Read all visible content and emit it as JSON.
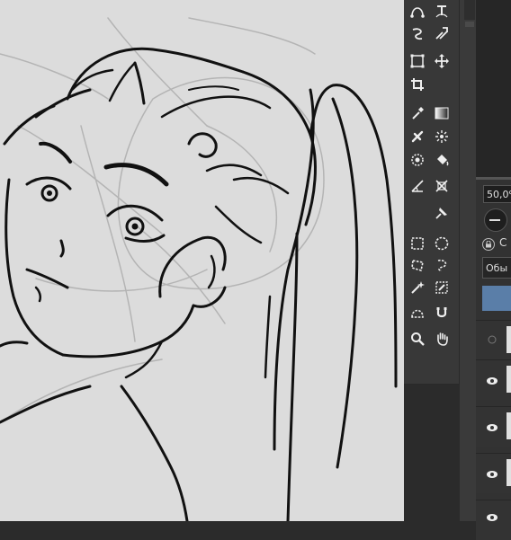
{
  "toolbox": {
    "tools": [
      {
        "name": "bezier-icon",
        "glyph": "bezier"
      },
      {
        "name": "path-text-icon",
        "glyph": "pathtext"
      },
      {
        "name": "freehand-path-icon",
        "glyph": "freepath"
      },
      {
        "name": "dynamic-brush-icon",
        "glyph": "dynamic"
      },
      {
        "name": "transform-icon",
        "glyph": "transform"
      },
      {
        "name": "move-icon",
        "glyph": "move"
      },
      {
        "name": "crop-icon",
        "glyph": "crop"
      },
      {
        "name": "gradient-icon",
        "glyph": "gradient"
      },
      {
        "name": "eyedropper-icon",
        "glyph": "eyedropper"
      },
      {
        "name": "colorize-mask-icon",
        "glyph": "colorize"
      },
      {
        "name": "smart-patch-icon",
        "glyph": "patch"
      },
      {
        "name": "fill-bucket-icon",
        "glyph": "bucket"
      },
      {
        "name": "enclose-fill-icon",
        "glyph": "enclose"
      },
      {
        "name": "assistant-icon",
        "glyph": "assistant"
      },
      {
        "name": "measure-icon",
        "glyph": "measure"
      },
      {
        "name": "reference-pin-icon",
        "glyph": "pin"
      },
      {
        "name": "rect-select-icon",
        "glyph": "rectsel"
      },
      {
        "name": "ellipse-select-icon",
        "glyph": "ellsel"
      },
      {
        "name": "polygon-select-icon",
        "glyph": "polysel"
      },
      {
        "name": "freehand-select-icon",
        "glyph": "freesel"
      },
      {
        "name": "magic-wand-icon",
        "glyph": "wand"
      },
      {
        "name": "similar-select-icon",
        "glyph": "similar"
      },
      {
        "name": "bezier-select-icon",
        "glyph": "beziersel"
      },
      {
        "name": "magnetic-select-icon",
        "glyph": "magnetic"
      },
      {
        "name": "zoom-icon",
        "glyph": "zoom"
      },
      {
        "name": "pan-icon",
        "glyph": "pan"
      }
    ]
  },
  "layers_panel": {
    "opacity_value": "50,0%",
    "lock_label": "С",
    "blend_mode": "Обы",
    "selected_layer_color": "#5a7ea8"
  }
}
